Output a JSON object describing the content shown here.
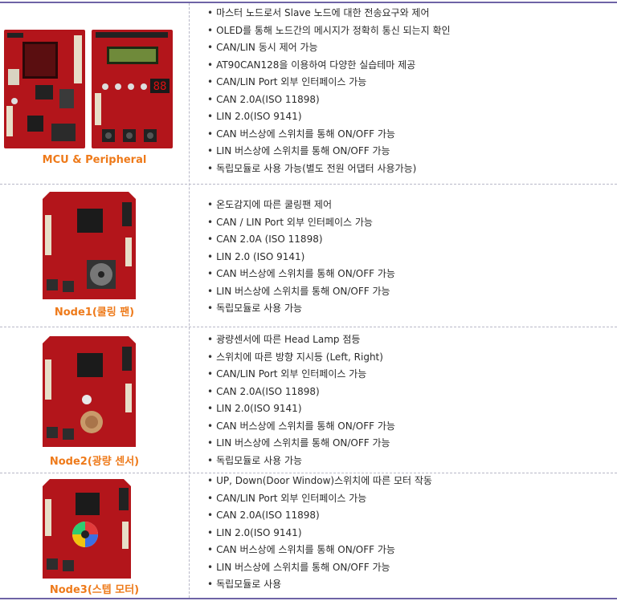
{
  "rows": [
    {
      "caption": "MCU & Peripheral",
      "items": [
        "마스터 노드로서 Slave 노드에 대한 전송요구와 제어",
        "OLED를 통해 노드간의 메시지가 정확히 통신 되는지 확인",
        "CAN/LIN 동시 제어 가능",
        "AT90CAN128을 이용하여 다양한 실습테마 제공",
        "CAN/LIN Port 외부 인터페이스 가능",
        "CAN 2.0A(ISO 11898)",
        "LIN 2.0(ISO 9141)",
        "CAN 버스상에 스위치를 통해 ON/OFF 가능",
        "LIN 버스상에 스위치를 통해 ON/OFF 가능",
        "독립모듈로 사용 가능(별도 전원 어댑터 사용가능)"
      ]
    },
    {
      "caption": "Node1(쿨링 팬)",
      "items": [
        "온도감지에 따른 쿨링팬 제어",
        "CAN / LIN Port 외부 인터페이스 가능",
        "CAN 2.0A (ISO 11898)",
        "LIN 2.0 (ISO 9141)",
        "CAN 버스상에 스위치를 통해 ON/OFF 가능",
        "LIN 버스상에 스위치를 통해 ON/OFF 가능",
        "독립모듈로 사용 가능"
      ]
    },
    {
      "caption": "Node2(광량 센서)",
      "items": [
        "광량센서에 따른 Head Lamp 점등",
        "스위치에 따른 방향 지시등 (Left, Right)",
        "CAN/LIN Port 외부 인터페이스 가능",
        "CAN 2.0A(ISO 11898)",
        "LIN 2.0(ISO 9141)",
        "CAN 버스상에 스위치를 통해 ON/OFF 가능",
        "LIN 버스상에 스위치를 통해 ON/OFF 가능",
        "독립모듈로 사용 가능"
      ]
    },
    {
      "caption": "Node3(스텝 모터)",
      "items": [
        "UP, Down(Door Window)스위치에 따른 모터 작동",
        "CAN/LIN Port 외부 인터페이스 가능",
        "CAN 2.0A(ISO 11898)",
        "LIN 2.0(ISO 9141)",
        "CAN 버스상에 스위치를 통해 ON/OFF 가능",
        "LIN 버스상에 스위치를 통해 ON/OFF 가능",
        "독립모듈로 사용"
      ]
    }
  ],
  "colors": {
    "caption": "#ee7a1a",
    "rule": "#6e63a6",
    "pcb": "#b3151b"
  },
  "display_digits": "88"
}
